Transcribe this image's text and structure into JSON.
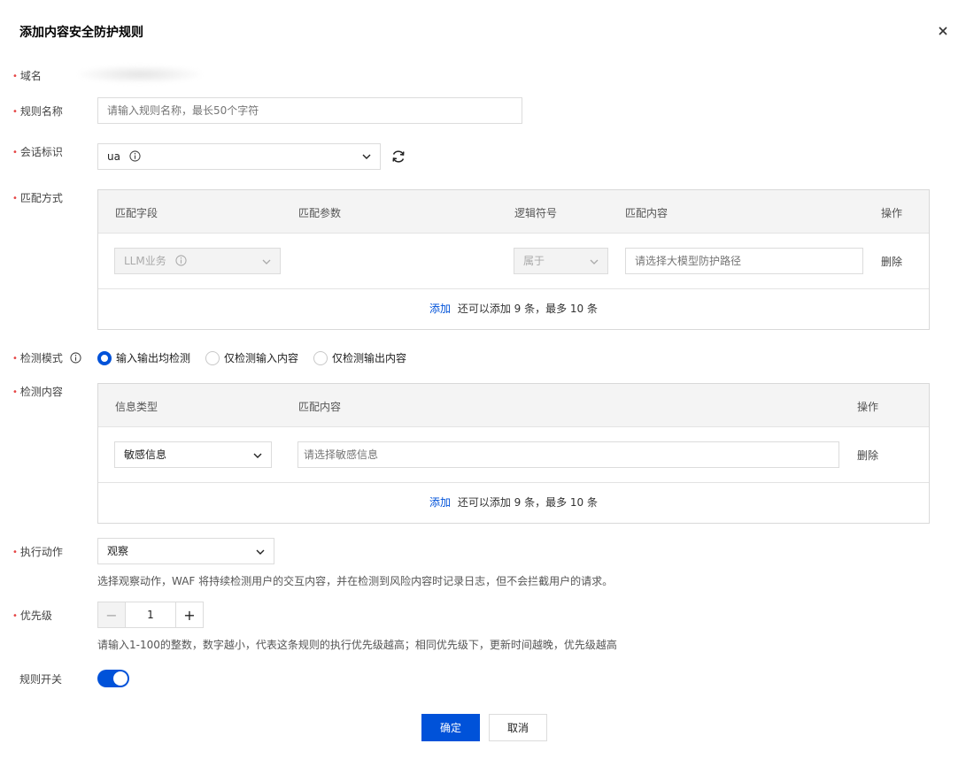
{
  "dialog": {
    "title": "添加内容安全防护规则",
    "close_icon": "close-icon"
  },
  "form": {
    "domain": {
      "label": "域名"
    },
    "rule_name": {
      "label": "规则名称",
      "placeholder": "请输入规则名称，最长50个字符"
    },
    "session_id": {
      "label": "会话标识",
      "value": "ua",
      "refresh_icon": "refresh-icon"
    },
    "match_mode": {
      "label": "匹配方式",
      "headers": [
        "匹配字段",
        "匹配参数",
        "逻辑符号",
        "匹配内容",
        "操作"
      ],
      "row": {
        "field": "LLM业务",
        "logic": "属于",
        "content_placeholder": "请选择大模型防护路径",
        "delete": "删除"
      },
      "footer": {
        "add": "添加",
        "remaining": "还可以添加 9 条，最多 10 条"
      }
    },
    "detect_mode": {
      "label": "检测模式",
      "options": [
        "输入输出均检测",
        "仅检测输入内容",
        "仅检测输出内容"
      ],
      "selected_index": 0
    },
    "detect_content": {
      "label": "检测内容",
      "headers": [
        "信息类型",
        "匹配内容",
        "操作"
      ],
      "row": {
        "type": "敏感信息",
        "content_placeholder": "请选择敏感信息",
        "delete": "删除"
      },
      "footer": {
        "add": "添加",
        "remaining": "还可以添加 9 条，最多 10 条"
      }
    },
    "action": {
      "label": "执行动作",
      "value": "观察",
      "hint": "选择观察动作，WAF 将持续检测用户的交互内容，并在检测到风险内容时记录日志，但不会拦截用户的请求。"
    },
    "priority": {
      "label": "优先级",
      "value": "1",
      "minus": "−",
      "plus": "+",
      "hint": "请输入1-100的整数，数字越小，代表这条规则的执行优先级越高；相同优先级下，更新时间越晚，优先级越高"
    },
    "switch": {
      "label": "规则开关",
      "on": true
    }
  },
  "buttons": {
    "confirm": "确定",
    "cancel": "取消"
  },
  "colors": {
    "primary": "#0052d9",
    "required": "#e54545"
  }
}
